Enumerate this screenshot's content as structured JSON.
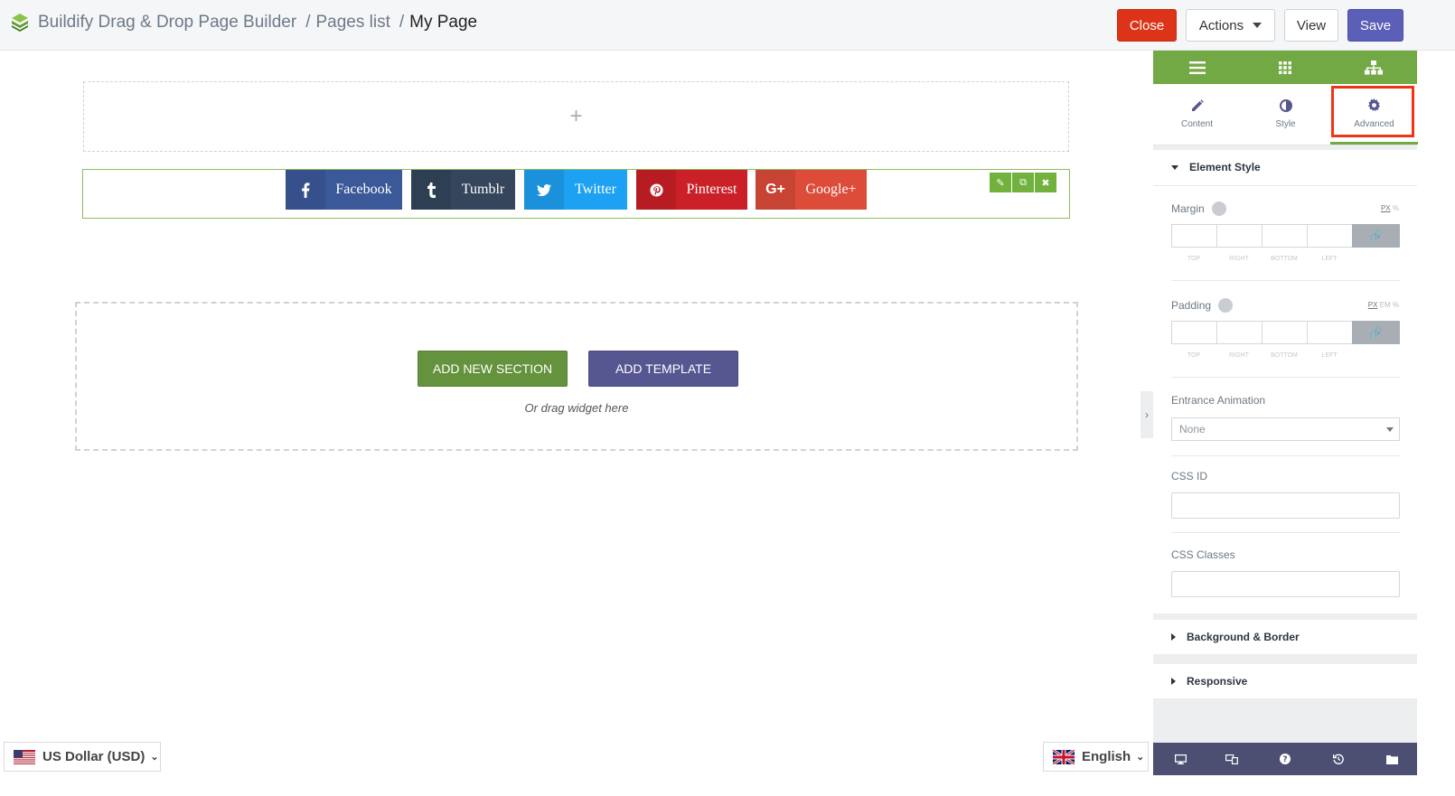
{
  "header": {
    "breadcrumb": [
      "Buildify Drag & Drop Page Builder",
      "Pages list",
      "My Page"
    ],
    "separator": "/",
    "buttons": {
      "close": "Close",
      "actions": "Actions",
      "view": "View",
      "save": "Save"
    }
  },
  "canvas": {
    "add_placeholder": "+",
    "share_buttons": [
      {
        "label": "Facebook",
        "icon": "facebook-icon",
        "color": "#3b5998",
        "icon_bg": "#35508a"
      },
      {
        "label": "Tumblr",
        "icon": "tumblr-icon",
        "color": "#35465c",
        "icon_bg": "#2f3f53"
      },
      {
        "label": "Twitter",
        "icon": "twitter-icon",
        "color": "#1da1f2",
        "icon_bg": "#1a91da"
      },
      {
        "label": "Pinterest",
        "icon": "pinterest-icon",
        "color": "#cb2027",
        "icon_bg": "#b71c23"
      },
      {
        "label": "Google+",
        "icon": "google-plus-icon",
        "color": "#dd4b39",
        "icon_bg": "#c74333"
      }
    ],
    "dropzone": {
      "add_section": "ADD NEW SECTION",
      "add_template": "ADD TEMPLATE",
      "hint": "Or drag widget here"
    }
  },
  "footer": {
    "currency": "US Dollar (USD)",
    "language": "English"
  },
  "panel": {
    "tabs": [
      {
        "label": "Content",
        "icon": "pencil-icon"
      },
      {
        "label": "Style",
        "icon": "half-circle-icon"
      },
      {
        "label": "Advanced",
        "icon": "gear-icon",
        "active": true
      }
    ],
    "element_style": {
      "title": "Element Style",
      "margin": {
        "label": "Margin",
        "units": [
          "PX",
          "%"
        ],
        "sides": [
          "TOP",
          "RIGHT",
          "BOTTOM",
          "LEFT"
        ]
      },
      "padding": {
        "label": "Padding",
        "units": [
          "PX",
          "EM",
          "%"
        ],
        "sides": [
          "TOP",
          "RIGHT",
          "BOTTOM",
          "LEFT"
        ]
      },
      "entrance_animation": {
        "label": "Entrance Animation",
        "value": "None"
      },
      "css_id": {
        "label": "CSS ID",
        "value": ""
      },
      "css_classes": {
        "label": "CSS Classes",
        "value": ""
      }
    },
    "collapsed_sections": [
      "Background & Border",
      "Responsive"
    ]
  },
  "colors": {
    "accent_green": "#72a944",
    "highlight_red": "#ee3517",
    "panel_footer": "#4c4f72"
  }
}
